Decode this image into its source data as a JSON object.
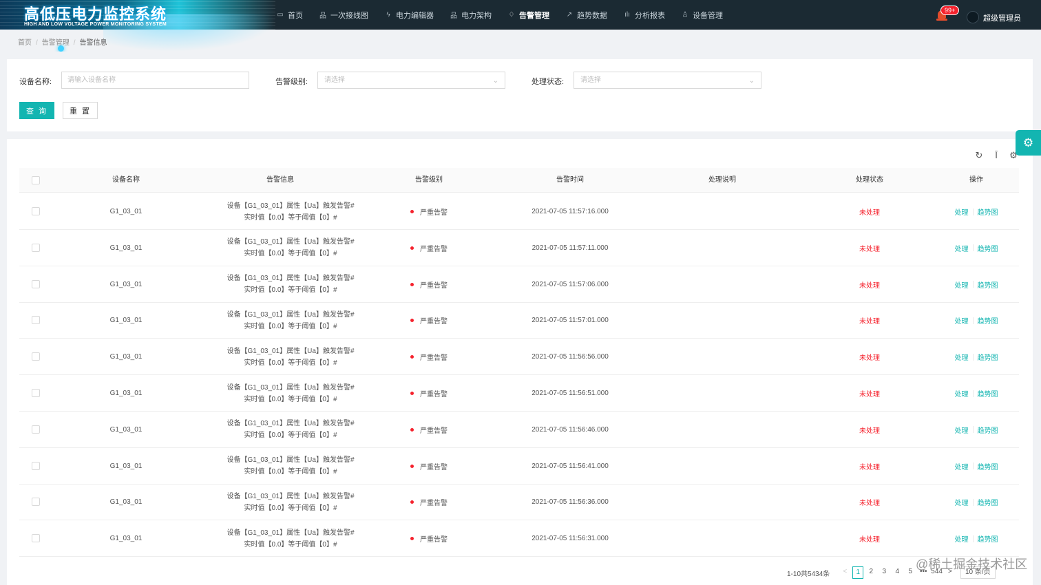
{
  "app": {
    "title": "高低压电力监控系统",
    "subtitle": "HIGH AND LOW VOLTAGE POWER MONITORING SYSTEM"
  },
  "nav": [
    {
      "label": "首页",
      "icon": "monitor-icon",
      "glyph": "▭",
      "active": false
    },
    {
      "label": "一次接线图",
      "icon": "diagram-icon",
      "glyph": "品",
      "active": false
    },
    {
      "label": "电力编辑器",
      "icon": "bolt-icon",
      "glyph": "ϟ",
      "active": false
    },
    {
      "label": "电力架构",
      "icon": "structure-icon",
      "glyph": "品",
      "active": false
    },
    {
      "label": "告警管理",
      "icon": "alarm-icon",
      "glyph": "♢",
      "active": true
    },
    {
      "label": "趋势数据",
      "icon": "line-chart-icon",
      "glyph": "↗",
      "active": false
    },
    {
      "label": "分析报表",
      "icon": "bar-chart-icon",
      "glyph": "ılı",
      "active": false
    },
    {
      "label": "设备管理",
      "icon": "device-icon",
      "glyph": "♙",
      "active": false
    }
  ],
  "notifications": {
    "count": "99+"
  },
  "user": {
    "name": "超级管理员"
  },
  "breadcrumb": [
    "首页",
    "告警管理",
    "告警信息"
  ],
  "search": {
    "device_label": "设备名称:",
    "device_placeholder": "请输入设备名称",
    "level_label": "告警级别:",
    "level_placeholder": "请选择",
    "status_label": "处理状态:",
    "status_placeholder": "请选择",
    "query_button": "查 询",
    "reset_button": "重 置"
  },
  "table": {
    "columns": [
      "设备名称",
      "告警信息",
      "告警级别",
      "告警时间",
      "处理说明",
      "处理状态",
      "操作"
    ],
    "rows": [
      {
        "device": "G1_03_01",
        "msg1": "设备【G1_03_01】属性【Ua】触发告警#",
        "msg2": "实时值【0.0】等于阈值【0】#",
        "level": "严重告警",
        "time": "2021-07-05 11:57:16.000",
        "note": "",
        "status": "未处理",
        "action1": "处理",
        "action2": "趋势图"
      },
      {
        "device": "G1_03_01",
        "msg1": "设备【G1_03_01】属性【Ua】触发告警#",
        "msg2": "实时值【0.0】等于阈值【0】#",
        "level": "严重告警",
        "time": "2021-07-05 11:57:11.000",
        "note": "",
        "status": "未处理",
        "action1": "处理",
        "action2": "趋势图"
      },
      {
        "device": "G1_03_01",
        "msg1": "设备【G1_03_01】属性【Ua】触发告警#",
        "msg2": "实时值【0.0】等于阈值【0】#",
        "level": "严重告警",
        "time": "2021-07-05 11:57:06.000",
        "note": "",
        "status": "未处理",
        "action1": "处理",
        "action2": "趋势图"
      },
      {
        "device": "G1_03_01",
        "msg1": "设备【G1_03_01】属性【Ua】触发告警#",
        "msg2": "实时值【0.0】等于阈值【0】#",
        "level": "严重告警",
        "time": "2021-07-05 11:57:01.000",
        "note": "",
        "status": "未处理",
        "action1": "处理",
        "action2": "趋势图"
      },
      {
        "device": "G1_03_01",
        "msg1": "设备【G1_03_01】属性【Ua】触发告警#",
        "msg2": "实时值【0.0】等于阈值【0】#",
        "level": "严重告警",
        "time": "2021-07-05 11:56:56.000",
        "note": "",
        "status": "未处理",
        "action1": "处理",
        "action2": "趋势图"
      },
      {
        "device": "G1_03_01",
        "msg1": "设备【G1_03_01】属性【Ua】触发告警#",
        "msg2": "实时值【0.0】等于阈值【0】#",
        "level": "严重告警",
        "time": "2021-07-05 11:56:51.000",
        "note": "",
        "status": "未处理",
        "action1": "处理",
        "action2": "趋势图"
      },
      {
        "device": "G1_03_01",
        "msg1": "设备【G1_03_01】属性【Ua】触发告警#",
        "msg2": "实时值【0.0】等于阈值【0】#",
        "level": "严重告警",
        "time": "2021-07-05 11:56:46.000",
        "note": "",
        "status": "未处理",
        "action1": "处理",
        "action2": "趋势图"
      },
      {
        "device": "G1_03_01",
        "msg1": "设备【G1_03_01】属性【Ua】触发告警#",
        "msg2": "实时值【0.0】等于阈值【0】#",
        "level": "严重告警",
        "time": "2021-07-05 11:56:41.000",
        "note": "",
        "status": "未处理",
        "action1": "处理",
        "action2": "趋势图"
      },
      {
        "device": "G1_03_01",
        "msg1": "设备【G1_03_01】属性【Ua】触发告警#",
        "msg2": "实时值【0.0】等于阈值【0】#",
        "level": "严重告警",
        "time": "2021-07-05 11:56:36.000",
        "note": "",
        "status": "未处理",
        "action1": "处理",
        "action2": "趋势图"
      },
      {
        "device": "G1_03_01",
        "msg1": "设备【G1_03_01】属性【Ua】触发告警#",
        "msg2": "实时值【0.0】等于阈值【0】#",
        "level": "严重告警",
        "time": "2021-07-05 11:56:31.000",
        "note": "",
        "status": "未处理",
        "action1": "处理",
        "action2": "趋势图"
      }
    ]
  },
  "pagination": {
    "total_text": "1-10共5434条",
    "prev": "<",
    "pages": [
      "1",
      "2",
      "3",
      "4",
      "5",
      "•••",
      "544"
    ],
    "current": "1",
    "next": ">",
    "page_size": "10 条/页"
  },
  "toolbar": {
    "refresh_glyph": "↻",
    "density_glyph": "Ī",
    "settings_glyph": "⚙"
  },
  "settings_tab": {
    "glyph": "⚙"
  },
  "watermark": "@稀土掘金技术社区",
  "colors": {
    "primary": "#13b5b1",
    "danger": "#f5222d",
    "header_bg": "#1b2a33"
  }
}
